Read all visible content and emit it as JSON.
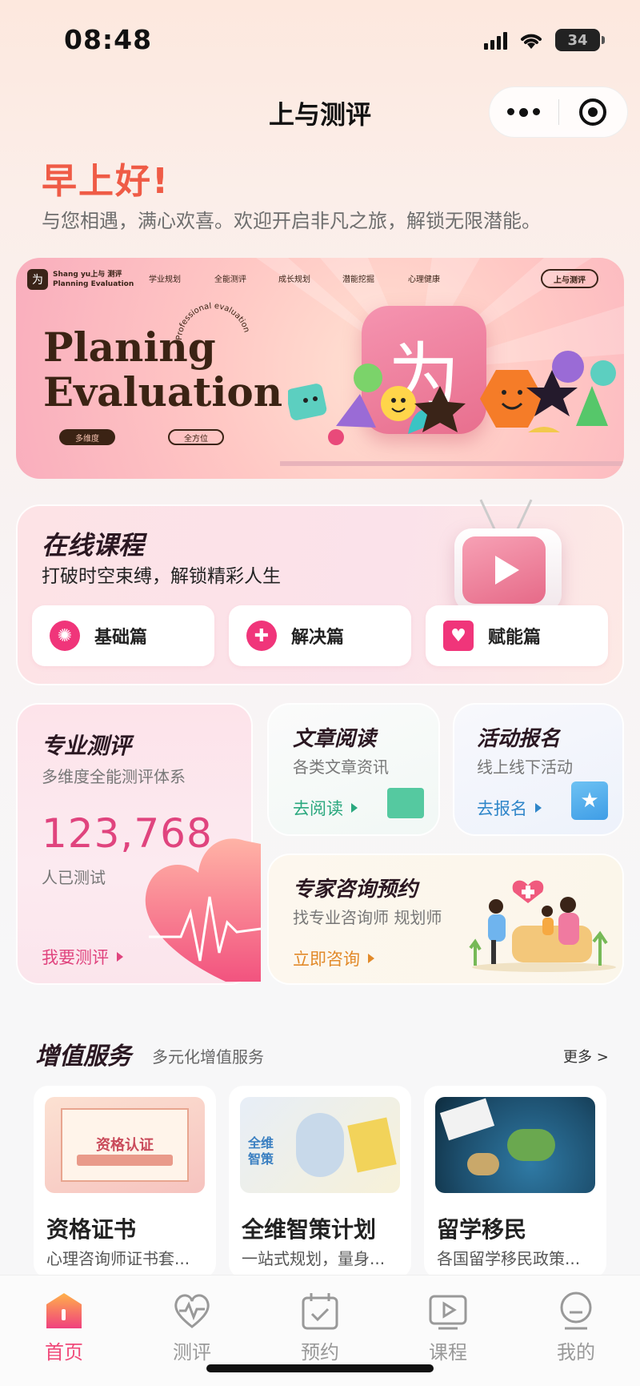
{
  "status_bar": {
    "time": "08:48",
    "battery": "34"
  },
  "nav": {
    "title": "上与测评"
  },
  "greeting": {
    "title": "早上好!",
    "subtitle": "与您相遇，满心欢喜。欢迎开启非凡之旅，解锁无限潜能。"
  },
  "banner": {
    "logo_line1": "Shang yu上与 测评",
    "logo_line2": "Planning Evaluation",
    "nav_items": [
      "学业规划",
      "全能测评",
      "成长规划",
      "潜能挖掘",
      "心理健康"
    ],
    "button": "上与测评",
    "title_line1": "Planing",
    "title_line2": "Evaluation",
    "ring_text": "Professional evaluation",
    "pill1": "多维度",
    "pill2": "全方位"
  },
  "online_course": {
    "title": "在线课程",
    "subtitle": "打破时空束缚，解锁精彩人生",
    "buttons": [
      {
        "label": "基础篇",
        "icon": "brain-icon"
      },
      {
        "label": "解决篇",
        "icon": "heart-plus-icon"
      },
      {
        "label": "赋能篇",
        "icon": "house-heart-icon"
      }
    ]
  },
  "evaluation": {
    "title": "专业测评",
    "subtitle": "多维度全能测评体系",
    "count": "123,768",
    "count_label": "人已测试",
    "link": "我要测评"
  },
  "reading": {
    "title": "文章阅读",
    "subtitle": "各类文章资讯",
    "link": "去阅读"
  },
  "activity": {
    "title": "活动报名",
    "subtitle": "线上线下活动",
    "link": "去报名"
  },
  "consult": {
    "title": "专家咨询预约",
    "subtitle": "找专业咨询师 规划师",
    "link": "立即咨询"
  },
  "value_added": {
    "title": "增值服务",
    "subtitle": "多元化增值服务",
    "more": "更多 >",
    "items": [
      {
        "title": "资格证书",
        "desc": "心理咨询师证书套...",
        "img_text": "资格认证"
      },
      {
        "title": "全维智策计划",
        "desc": "一站式规划，量身...",
        "img_text": "全维智策"
      },
      {
        "title": "留学移民",
        "desc": "各国留学移民政策...",
        "img_text": ""
      }
    ]
  },
  "tabbar": [
    {
      "label": "首页",
      "icon": "home-icon",
      "active": true
    },
    {
      "label": "测评",
      "icon": "heartbeat-icon",
      "active": false
    },
    {
      "label": "预约",
      "icon": "calendar-check-icon",
      "active": false
    },
    {
      "label": "课程",
      "icon": "video-play-icon",
      "active": false
    },
    {
      "label": "我的",
      "icon": "user-icon",
      "active": false
    }
  ],
  "colors": {
    "accent": "#f04a7a",
    "greeting": "#ef5b46",
    "count": "#e0447e",
    "read_link": "#2aa87e",
    "act_link": "#2f86c9",
    "consult_link": "#e28a2a"
  }
}
